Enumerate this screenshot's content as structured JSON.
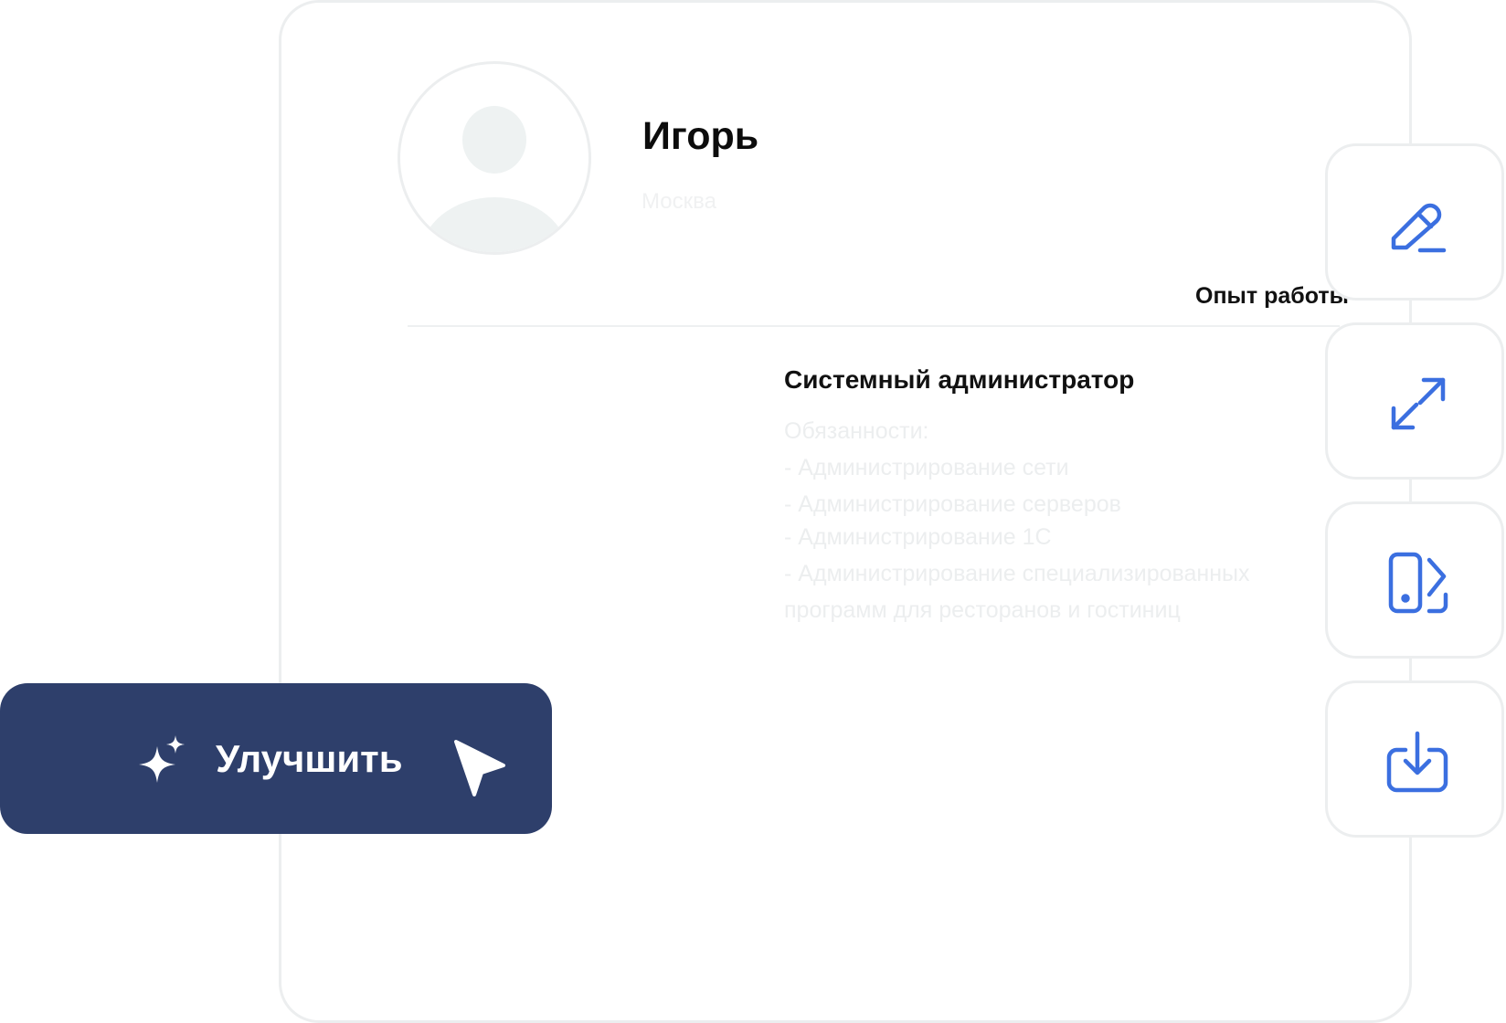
{
  "profile": {
    "name": "Игорь",
    "city": "Москва"
  },
  "section": {
    "experience_label": "Опыт работы"
  },
  "job": {
    "title": "Системный администратор",
    "duties": [
      "Обязанности:",
      "- Администрирование сети",
      "- Администрирование серверов",
      "- Администрирование 1С",
      "- Администрирование специализированных",
      "программ для ресторанов и гостиниц"
    ]
  },
  "actions": {
    "improve_label": "Улучшить"
  },
  "toolbar": {
    "icons": [
      "edit-icon",
      "expand-icon",
      "mobile-view-icon",
      "download-icon"
    ]
  },
  "colors": {
    "accent": "#3b6fe0",
    "button_bg": "#2e3f6b",
    "border": "#eceeef"
  }
}
